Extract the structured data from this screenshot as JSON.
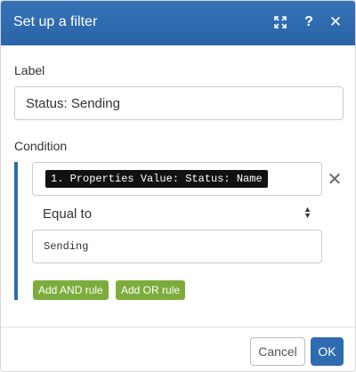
{
  "dialog": {
    "title": "Set up a filter",
    "icons": [
      "expand-icon",
      "help-icon",
      "close-icon"
    ]
  },
  "label_field": {
    "label": "Label",
    "value": "Status: Sending"
  },
  "condition": {
    "label": "Condition",
    "operand_a": "1. Properties Value: Status: Name",
    "operator": "Equal to",
    "operand_b": "Sending",
    "add_and": "Add AND rule",
    "add_or": "Add OR rule"
  },
  "footer": {
    "cancel": "Cancel",
    "ok": "OK"
  },
  "colors": {
    "header": "#2e6bb1",
    "green": "#7cad3c",
    "primary": "#2e6bb1"
  }
}
